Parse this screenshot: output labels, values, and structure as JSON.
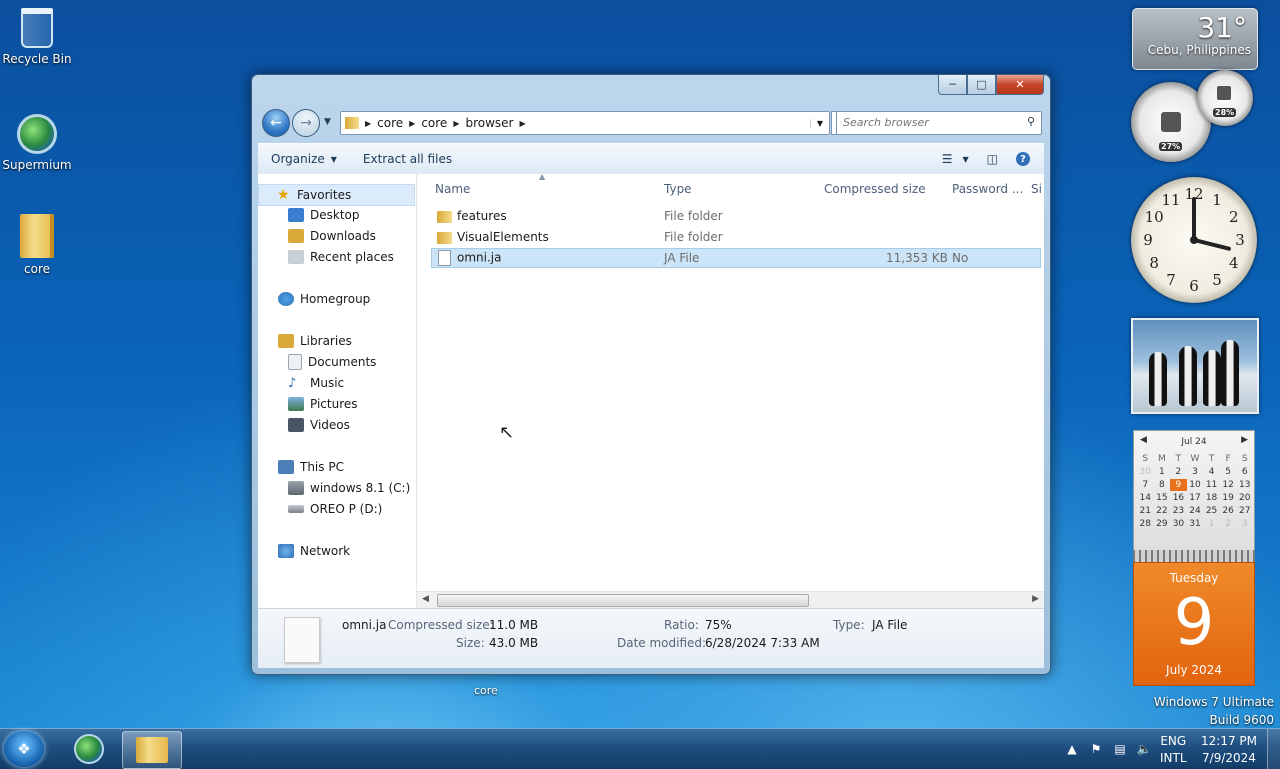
{
  "desktop": {
    "icons": [
      {
        "label": "Recycle Bin"
      },
      {
        "label": "Supermium"
      },
      {
        "label": "core"
      }
    ],
    "stray_label": "core",
    "version": {
      "line1": "Windows 7 Ultimate",
      "line2": "Build 9600"
    }
  },
  "explorer": {
    "address": {
      "segments": [
        "core",
        "core",
        "browser"
      ]
    },
    "search": {
      "placeholder": "Search browser"
    },
    "toolbar": {
      "organize": "Organize",
      "extract": "Extract all files"
    },
    "nav": {
      "favorites": "Favorites",
      "desktop": "Desktop",
      "downloads": "Downloads",
      "recent": "Recent places",
      "homegroup": "Homegroup",
      "libraries": "Libraries",
      "documents": "Documents",
      "music": "Music",
      "pictures": "Pictures",
      "videos": "Videos",
      "thispc": "This PC",
      "drive_c": "windows 8.1 (C:)",
      "drive_d": "OREO P (D:)",
      "network": "Network"
    },
    "columns": {
      "name": "Name",
      "type": "Type",
      "compressed": "Compressed size",
      "password": "Password ...",
      "size": "Si"
    },
    "files": [
      {
        "name": "features",
        "type": "File folder",
        "compressed": "",
        "password": ""
      },
      {
        "name": "VisualElements",
        "type": "File folder",
        "compressed": "",
        "password": ""
      },
      {
        "name": "omni.ja",
        "type": "JA File",
        "compressed": "11,353 KB",
        "password": "No"
      }
    ],
    "details": {
      "filename": "omni.ja",
      "compressed_label": "Compressed size:",
      "compressed_value": "11.0 MB",
      "size_label": "Size:",
      "size_value": "43.0 MB",
      "ratio_label": "Ratio:",
      "ratio_value": "75%",
      "modified_label": "Date modified:",
      "modified_value": "6/28/2024 7:33 AM",
      "type_label": "Type:",
      "type_value": "JA File"
    }
  },
  "gadgets": {
    "weather": {
      "temp": "31°",
      "city": "Cebu, Philippines"
    },
    "meters": {
      "cpu": "27%",
      "mem": "28%"
    },
    "clock_numbers": [
      "12",
      "1",
      "2",
      "3",
      "4",
      "5",
      "6",
      "7",
      "8",
      "9",
      "10",
      "11"
    ],
    "calendar": {
      "month_short": "Jul 24",
      "weekdays": [
        "S",
        "M",
        "T",
        "W",
        "T",
        "F",
        "S"
      ],
      "days": [
        "30",
        "1",
        "2",
        "3",
        "4",
        "5",
        "6",
        "7",
        "8",
        "9",
        "10",
        "11",
        "12",
        "13",
        "14",
        "15",
        "16",
        "17",
        "18",
        "19",
        "20",
        "21",
        "22",
        "23",
        "24",
        "25",
        "26",
        "27",
        "28",
        "29",
        "30",
        "31",
        "1",
        "2",
        "3"
      ],
      "today": "9",
      "day_name": "Tuesday",
      "month_year": "July 2024"
    }
  },
  "taskbar": {
    "lang1": "ENG",
    "lang2": "INTL",
    "time": "12:17 PM",
    "date": "7/9/2024"
  }
}
